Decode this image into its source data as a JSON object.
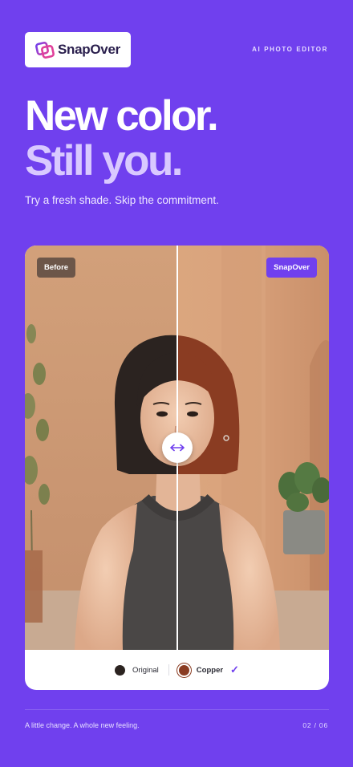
{
  "brand": {
    "name": "SnapOver",
    "category": "AI PHOTO EDITOR"
  },
  "headline": {
    "line1": "New color.",
    "line2": "Still you."
  },
  "subheadline": "Try a fresh shade. Skip the commitment.",
  "comparison": {
    "before_label": "Before",
    "after_label": "SnapOver",
    "divider_position": 0.5,
    "handle_icon": "left-right-arrow-icon"
  },
  "swatches": [
    {
      "label": "Original",
      "color": "#2b2320",
      "selected": false
    },
    {
      "label": "Copper",
      "color": "#8a3c22",
      "selected": true
    }
  ],
  "footer": {
    "tagline": "A little change. A whole new feeling.",
    "page": "02 / 06"
  },
  "colors": {
    "background": "#7040ee",
    "accent": "#7040ee",
    "headline_secondary": "#d9c9ff"
  }
}
